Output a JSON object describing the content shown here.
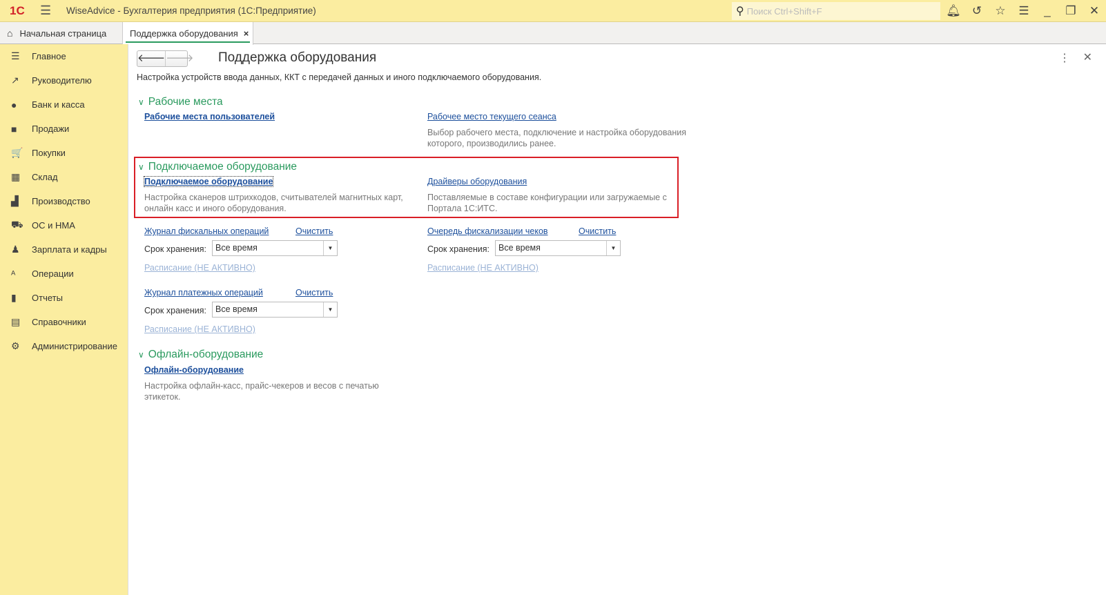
{
  "app": {
    "logo": "1С",
    "title": "WiseAdvice - Бухгалтерия предприятия  (1С:Предприятие)",
    "search_placeholder": "Поиск Ctrl+Shift+F"
  },
  "tabs": [
    {
      "label": "Начальная страница"
    },
    {
      "label": "Поддержка оборудования",
      "close": "×"
    }
  ],
  "sidebar": {
    "items": [
      {
        "label": "Главное",
        "icon": "☰"
      },
      {
        "label": "Руководителю",
        "icon": "↗"
      },
      {
        "label": "Банк и касса",
        "icon": "●"
      },
      {
        "label": "Продажи",
        "icon": "■"
      },
      {
        "label": "Покупки",
        "icon": "🛒"
      },
      {
        "label": "Склад",
        "icon": "▦"
      },
      {
        "label": "Производство",
        "icon": "▟"
      },
      {
        "label": "ОС и НМА",
        "icon": "⛟"
      },
      {
        "label": "Зарплата и кадры",
        "icon": "♟"
      },
      {
        "label": "Операции",
        "icon": "ᴬ"
      },
      {
        "label": "Отчеты",
        "icon": "▮"
      },
      {
        "label": "Справочники",
        "icon": "▤"
      },
      {
        "label": "Администрирование",
        "icon": "⚙"
      }
    ]
  },
  "page": {
    "title": "Поддержка оборудования",
    "description": "Настройка устройств ввода данных, ККТ с передачей данных и иного подключаемого оборудования.",
    "sections": {
      "workplaces": {
        "title": "Рабочие места",
        "link1": "Рабочие места пользователей",
        "link2": "Рабочее место текущего сеанса",
        "desc2": "Выбор рабочего места, подключение и настройка оборудования которого, производились ранее."
      },
      "equipment": {
        "title": "Подключаемое оборудование",
        "link1": "Подключаемое оборудование",
        "desc1": "Настройка сканеров штрихкодов, считывателей магнитных карт, онлайн касс и иного оборудования.",
        "link2": "Драйверы оборудования",
        "desc2": "Поставляемые в составе конфигурации или загружаемые с Портала 1С:ИТС."
      },
      "journals": [
        {
          "link": "Журнал фискальных операций",
          "clear": "Очистить",
          "storage_label": "Срок хранения:",
          "storage_value": "Все время",
          "schedule": "Расписание (НЕ АКТИВНО)"
        },
        {
          "link": "Очередь фискализации чеков",
          "clear": "Очистить",
          "storage_label": "Срок хранения:",
          "storage_value": "Все время",
          "schedule": "Расписание (НЕ АКТИВНО)"
        },
        {
          "link": "Журнал платежных операций",
          "clear": "Очистить",
          "storage_label": "Срок хранения:",
          "storage_value": "Все время",
          "schedule": "Расписание (НЕ АКТИВНО)"
        }
      ],
      "offline": {
        "title": "Офлайн-оборудование",
        "link1": "Офлайн-оборудование",
        "desc1": "Настройка офлайн-касс, прайс-чекеров и весов с печатью этикеток."
      }
    }
  }
}
